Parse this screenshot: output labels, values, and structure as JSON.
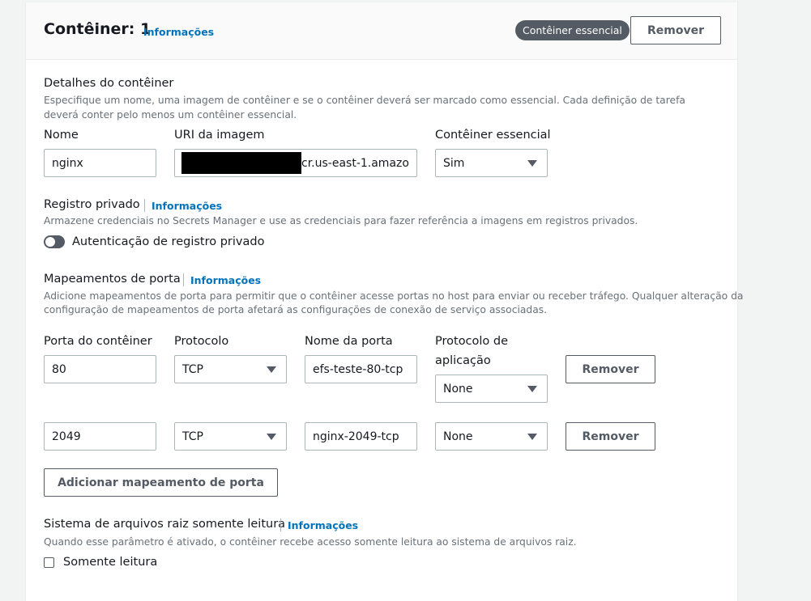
{
  "header": {
    "title": "Contêiner: 1",
    "info_link": "Informações",
    "essential_badge": "Contêiner essencial",
    "remove_button": "Remover"
  },
  "details": {
    "title": "Detalhes do contêiner",
    "description": "Especifique um nome, uma imagem de contêiner e se o contêiner deverá ser marcado como essencial. Cada definição de tarefa deverá conter pelo menos um contêiner essencial.",
    "name_label": "Nome",
    "name_value": "nginx",
    "image_label": "URI da imagem",
    "image_value_visible": "cr.us-east-1.amazo",
    "essential_label": "Contêiner essencial",
    "essential_value": "Sim"
  },
  "private_registry": {
    "title": "Registro privado",
    "info_link": "Informações",
    "description": "Armazene credenciais no Secrets Manager e use as credenciais para fazer referência a imagens em registros privados.",
    "toggle_label": "Autenticação de registro privado"
  },
  "port_mappings": {
    "title": "Mapeamentos de porta",
    "info_link": "Informações",
    "description_line1": "Adicione mapeamentos de porta para permitir que o contêiner acesse portas no host para enviar ou receber tráfego. Qualquer alteração da",
    "description_line2": "configuração de mapeamentos de porta afetará as configurações de conexão de serviço associadas.",
    "col_port": "Porta do contêiner",
    "col_protocol": "Protocolo",
    "col_port_name": "Nome da porta",
    "col_app_protocol_line1": "Protocolo de",
    "col_app_protocol_line2": "aplicação",
    "rows": [
      {
        "port": "80",
        "protocol": "TCP",
        "port_name": "efs-teste-80-tcp",
        "app_protocol": "None",
        "remove": "Remover"
      },
      {
        "port": "2049",
        "protocol": "TCP",
        "port_name": "nginx-2049-tcp",
        "app_protocol": "None",
        "remove": "Remover"
      }
    ],
    "add_button": "Adicionar mapeamento de porta"
  },
  "readonly_fs": {
    "title": "Sistema de arquivos raiz somente leitura",
    "info_link": "Informações",
    "description": "Quando esse parâmetro é ativado, o contêiner recebe acesso somente leitura ao sistema de arquivos raiz.",
    "checkbox_label": "Somente leitura"
  },
  "icons": {
    "toggle": "toggle-off-icon",
    "dropdown": "caret-down-icon",
    "checkbox": "checkbox-unchecked-icon"
  },
  "colors": {
    "link": "#0073bb",
    "badge_bg": "#545b64",
    "border": "#aab7b8",
    "text": "#16191f",
    "muted": "#687078"
  }
}
